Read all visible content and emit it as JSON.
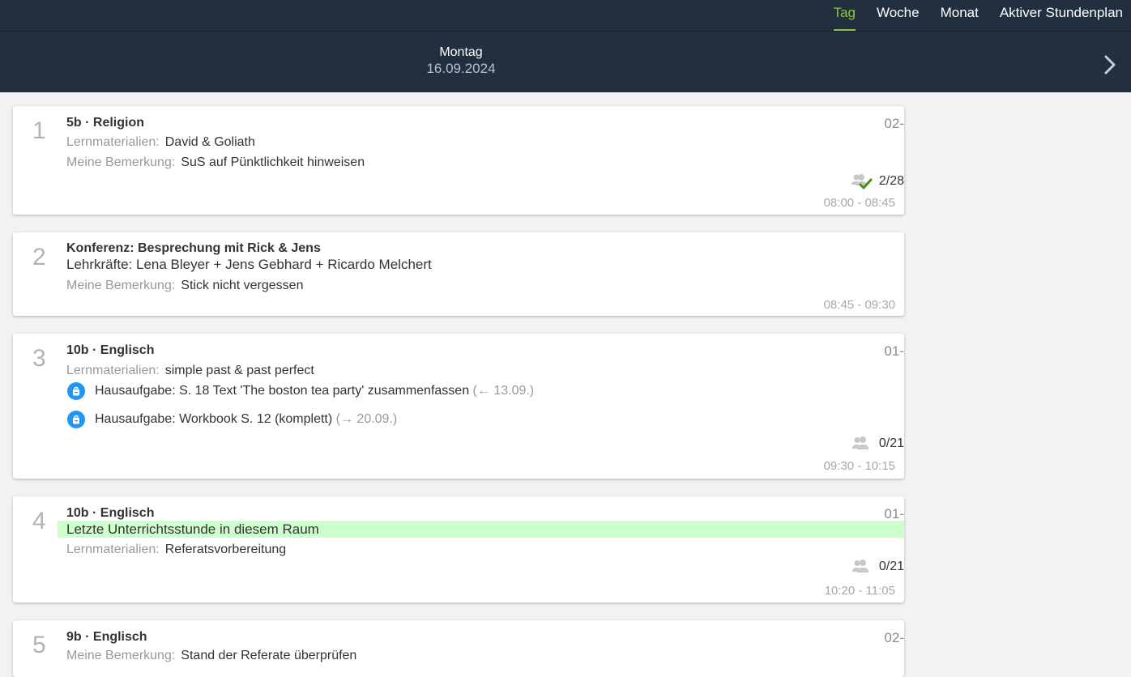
{
  "nav": {
    "tabs": [
      {
        "label": "Tag"
      },
      {
        "label": "Woche"
      },
      {
        "label": "Monat"
      },
      {
        "label": "Aktiver Stundenplan"
      }
    ],
    "active_tab": "Tag",
    "accent_color": "#8bc34a",
    "header_color": "#222f3e"
  },
  "day": {
    "weekday": "Montag",
    "date": "16.09.2024",
    "next_icon": "chevron-right-icon"
  },
  "labels": {
    "materials": "Lernmaterialien:",
    "remark": "Meine Bemerkung:"
  },
  "lessons": [
    {
      "number": "1",
      "title": "5b · Religion",
      "room": "02-",
      "materials": "David & Goliath",
      "remark": "SuS auf Pünktlichkeit hinweisen",
      "attendance": "2/28",
      "time": "08:00 - 08:45"
    },
    {
      "number": "2",
      "title": "Konferenz: Besprechung mit Rick & Jens",
      "teachers": "Lehrkräfte: Lena Bleyer + Jens Gebhard + Ricardo Melchert",
      "remark": "Stick nicht vergessen",
      "time": "08:45 - 09:30"
    },
    {
      "number": "3",
      "title": "10b · Englisch",
      "room": "01-",
      "materials": "simple past & past perfect",
      "homework": [
        {
          "text": "Hausaufgabe: S. 18 Text 'The boston tea party' zusammenfassen",
          "ref": "(← 13.09.)"
        },
        {
          "text": "Hausaufgabe: Workbook S. 12 (komplett)",
          "ref": "(→ 20.09.)"
        }
      ],
      "attendance": "0/21",
      "time": "09:30 - 10:15"
    },
    {
      "number": "4",
      "title": "10b · Englisch",
      "room": "01-",
      "notice": "Letzte Unterrichtsstunde in diesem Raum",
      "materials": "Referatsvorbereitung",
      "attendance": "0/21",
      "time": "10:20 - 11:05"
    },
    {
      "number": "5",
      "title": "9b · Englisch",
      "room": "02-",
      "remark": "Stand der Referate überprüfen"
    }
  ]
}
